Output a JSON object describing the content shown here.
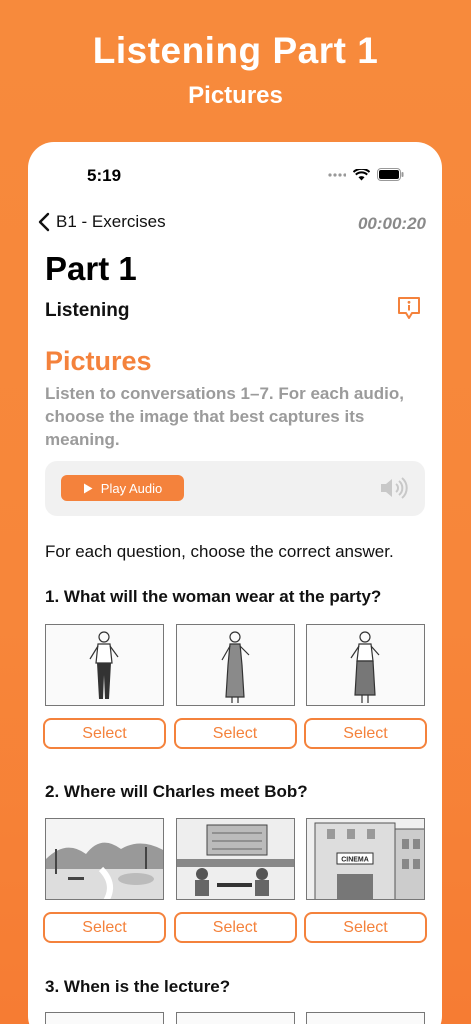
{
  "promo": {
    "title": "Listening Part 1",
    "subtitle": "Pictures"
  },
  "status": {
    "time": "5:19"
  },
  "nav": {
    "back_label": "B1 - Exercises",
    "timer": "00:00:20"
  },
  "header": {
    "part_title": "Part 1",
    "subtitle": "Listening"
  },
  "section": {
    "title": "Pictures",
    "instructions": "Listen to conversations 1–7. For each audio, choose the image that best captures its meaning."
  },
  "audio": {
    "play_label": "Play Audio"
  },
  "prompt": "For each question, choose the correct answer.",
  "questions": [
    {
      "text": "1. What will the woman wear at the party?",
      "options": [
        "Select",
        "Select",
        "Select"
      ]
    },
    {
      "text": "2. Where will Charles meet Bob?",
      "options": [
        "Select",
        "Select",
        "Select"
      ]
    },
    {
      "text": "3. When is the lecture?"
    }
  ],
  "colors": {
    "accent": "#f4823c",
    "background": "#f78a3c"
  },
  "icons": [
    "chevron-left-icon",
    "info-bubble-icon",
    "play-icon",
    "speaker-icon",
    "signal-icon",
    "wifi-icon",
    "battery-icon"
  ],
  "images": {
    "q2_cinema_sign": "CINEMA"
  }
}
